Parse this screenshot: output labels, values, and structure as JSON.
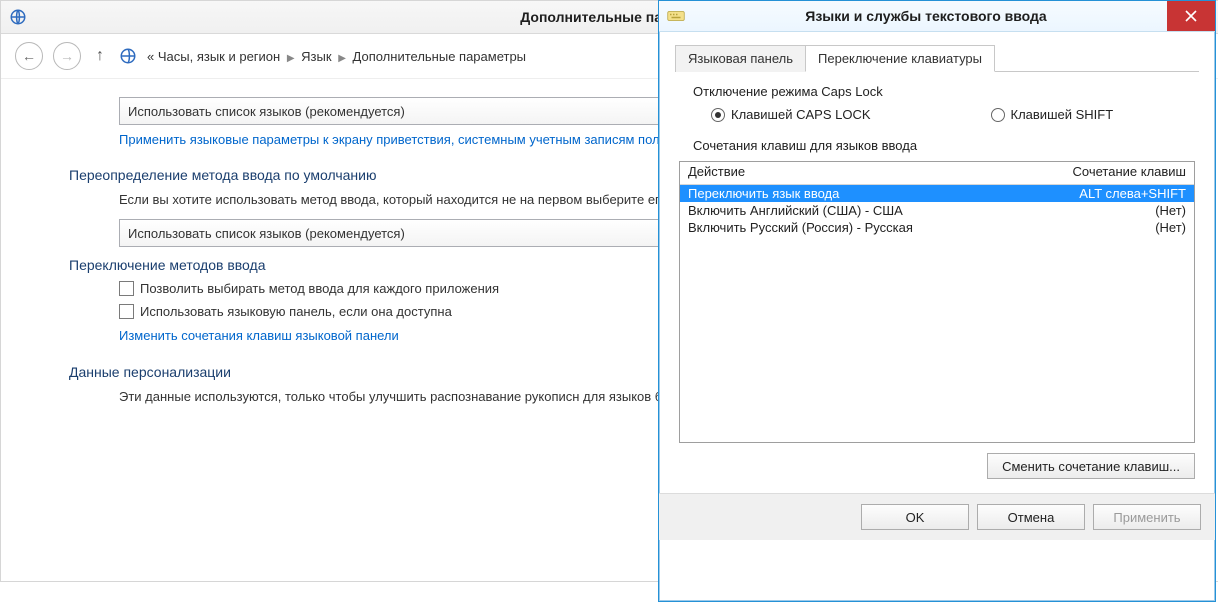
{
  "cp": {
    "title": "Дополнительные параметры",
    "breadcrumb": {
      "prefix": "«",
      "item1": "Часы, язык и регион",
      "item2": "Язык",
      "item3": "Дополнительные параметры"
    },
    "combo1": "Использовать список языков (рекомендуется)",
    "link1": "Применить языковые параметры к экрану приветствия, системным учетным записям пользователей",
    "sec2": "Переопределение метода ввода по умолчанию",
    "sec2_text": "Если вы хотите использовать метод ввода, который находится не на первом выберите его здесь.",
    "combo2": "Использовать список языков (рекомендуется)",
    "sec3": "Переключение методов ввода",
    "cb1": "Позволить выбирать метод ввода для каждого приложения",
    "cb2": "Использовать языковую панель, если она доступна",
    "link2": "Изменить сочетания клавиш языковой панели",
    "sec4": "Данные персонализации",
    "sec4_text": "Эти данные используются, только чтобы улучшить распознавание рукописн для языков без IME на этом компьютере. Никакая информация не отправля"
  },
  "dlg": {
    "title": "Языки и службы текстового ввода",
    "tab1": "Языковая панель",
    "tab2": "Переключение клавиатуры",
    "group1": "Отключение режима Caps Lock",
    "radio1": "Клавишей CAPS LOCK",
    "radio2": "Клавишей SHIFT",
    "group2": "Сочетания клавиш для языков ввода",
    "col_action": "Действие",
    "col_hotkey": "Сочетание клавиш",
    "rows": [
      {
        "action": "Переключить язык ввода",
        "hotkey": "ALT слева+SHIFT"
      },
      {
        "action": "Включить Английский (США) - США",
        "hotkey": "(Нет)"
      },
      {
        "action": "Включить Русский (Россия) - Русская",
        "hotkey": "(Нет)"
      }
    ],
    "btn_change": "Сменить сочетание клавиш...",
    "btn_ok": "OK",
    "btn_cancel": "Отмена",
    "btn_apply": "Применить"
  }
}
